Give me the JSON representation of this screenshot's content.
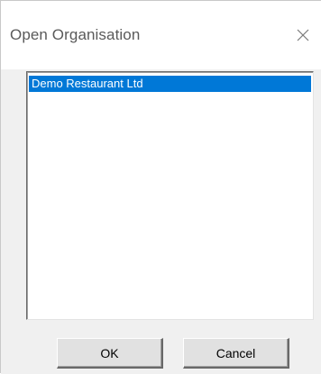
{
  "window": {
    "title": "Open Organisation",
    "close_icon": "close-icon"
  },
  "organisations": {
    "items": [
      {
        "label": "Demo Restaurant Ltd",
        "selected": true
      }
    ]
  },
  "buttons": {
    "ok_label": "OK",
    "cancel_label": "Cancel"
  },
  "colors": {
    "selection": "#0078d7",
    "dialog_bg": "#f0f0f0",
    "titlebar_bg": "#ffffff"
  }
}
